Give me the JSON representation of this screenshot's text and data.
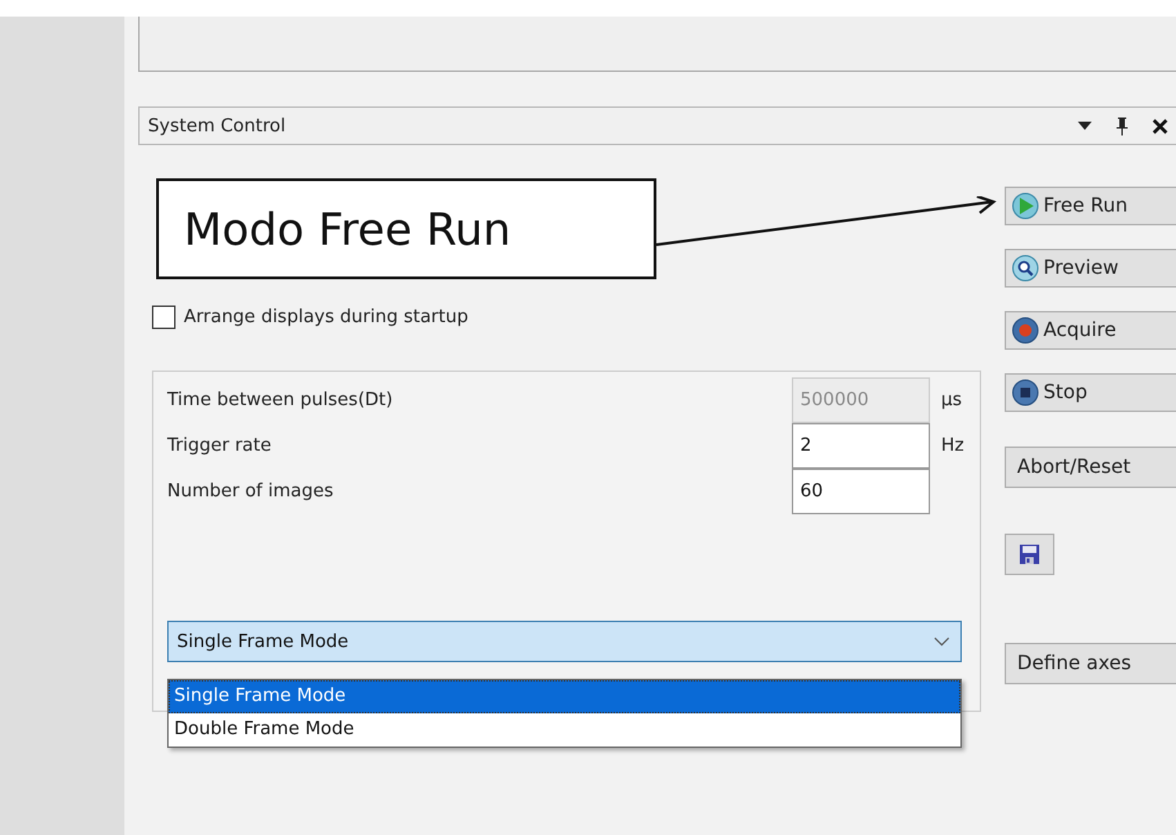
{
  "panel": {
    "title": "System Control"
  },
  "annotation": {
    "text": "Modo Free Run"
  },
  "checkbox": {
    "label": "Arrange displays during startup",
    "checked": false
  },
  "params": [
    {
      "label": "Time between pulses(Dt)",
      "value": "500000",
      "unit": "µs",
      "disabled": true
    },
    {
      "label": "Trigger rate",
      "value": "2",
      "unit": "Hz",
      "disabled": false
    },
    {
      "label": "Number of images",
      "value": "60",
      "disabled": false
    }
  ],
  "mode_select": {
    "value": "Single Frame Mode",
    "expanded": true,
    "options": [
      {
        "label": "Single Frame Mode",
        "selected": true
      },
      {
        "label": "Double Frame Mode",
        "selected": false
      }
    ]
  },
  "buttons": [
    {
      "kind": "run",
      "label": "Free Run"
    },
    {
      "kind": "preview",
      "label": "Preview"
    },
    {
      "kind": "acquire",
      "label": "Acquire"
    },
    {
      "kind": "stop",
      "label": "Stop"
    },
    {
      "kind": "text",
      "label": "Abort/Reset"
    },
    {
      "kind": "save"
    },
    {
      "kind": "text",
      "label": "Define axes"
    }
  ]
}
